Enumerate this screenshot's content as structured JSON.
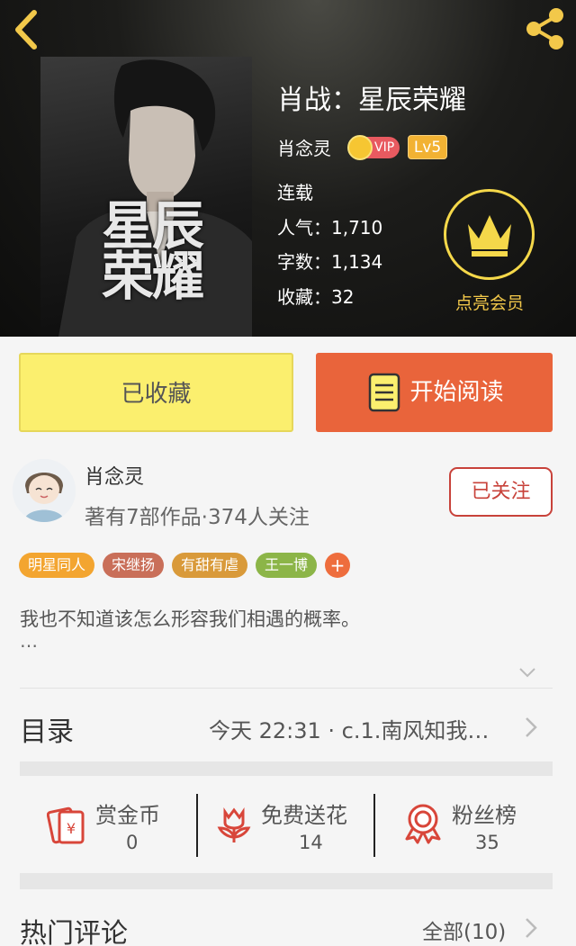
{
  "header": {
    "back_icon": "chevron-left-icon",
    "share_icon": "share-icon"
  },
  "cover": {
    "title_text": "星辰荣耀"
  },
  "book": {
    "title": "肖战：星辰荣耀",
    "author": "肖念灵",
    "vip_label": "VIP",
    "level": "Lv5",
    "status": "连载",
    "popularity": "人气：1,710",
    "word_count": "字数：1,134",
    "favorites": "收藏：32"
  },
  "vip_member": {
    "label": "点亮会员",
    "color": "#f5d84a"
  },
  "buttons": {
    "collected": "已收藏",
    "read": "开始阅读"
  },
  "author": {
    "name": "肖念灵",
    "meta": "著有7部作品·374人关注",
    "follow": "已关注"
  },
  "tags": [
    {
      "label": "明星同人",
      "color": "#f3a530"
    },
    {
      "label": "宋继扬",
      "color": "#c96f59"
    },
    {
      "label": "有甜有虐",
      "color": "#d99a3a"
    },
    {
      "label": "王一博",
      "color": "#8cb548"
    },
    {
      "label": "+",
      "color": "#ee6d3d"
    }
  ],
  "description": {
    "text": "我也不知道该怎么形容我们相遇的概率。",
    "ellipsis": "…"
  },
  "toc": {
    "label": "目录",
    "latest": "今天 22:31 · c.1.南风知我…"
  },
  "actions": [
    {
      "label": "赏金币",
      "count": "0",
      "icon": "red-envelope-icon"
    },
    {
      "label": "免费送花",
      "count": "14",
      "icon": "flower-icon"
    },
    {
      "label": "粉丝榜",
      "count": "35",
      "icon": "ribbon-medal-icon"
    }
  ],
  "comments": {
    "label": "热门评论",
    "all": "全部(10)"
  }
}
